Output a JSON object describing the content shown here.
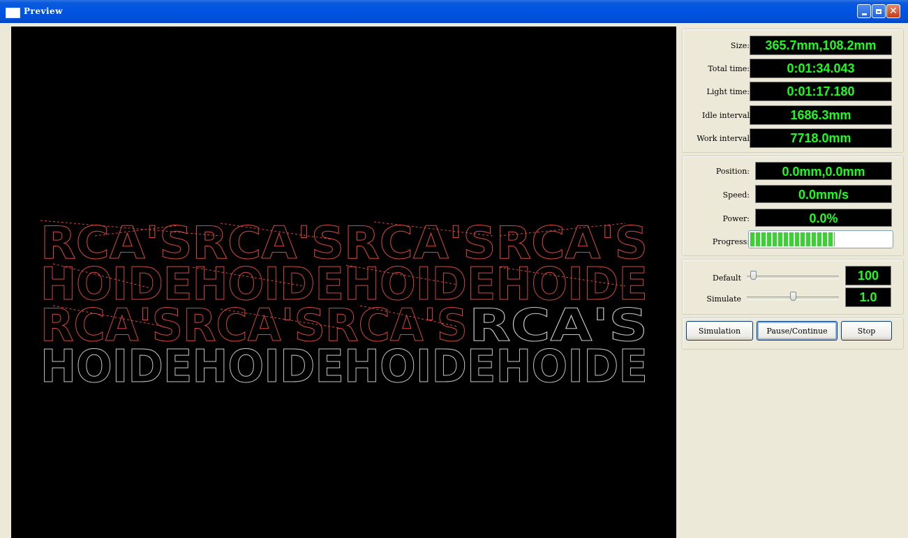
{
  "window": {
    "title": "Preview"
  },
  "colors": {
    "lcd_text": "#19ff19",
    "processed_path": "#d9473f",
    "pending_path": "#c8c8c8",
    "canvas_bg": "#000000"
  },
  "canvas": {
    "rows": [
      {
        "text": "RCA'SRCA'SRCA'SRCA'S",
        "state": "processed"
      },
      {
        "text": "HOIDEHOIDEHOIDEHOIDE",
        "state": "processed"
      },
      {
        "text": "RCA'SRCA'SRCA'S",
        "state": "processed"
      },
      {
        "text": "RCA'S",
        "state": "pending"
      },
      {
        "text": "HOIDEHOIDEHOIDEHOIDE",
        "state": "pending"
      }
    ]
  },
  "info": {
    "size_label": "Size:",
    "size_value": "365.7mm,108.2mm",
    "total_time_label": "Total time:",
    "total_time_value": "0:01:34.043",
    "light_time_label": "Light time:",
    "light_time_value": "0:01:17.180",
    "idle_interval_label": "Idle interval",
    "idle_interval_value": "1686.3mm",
    "work_interval_label": "Work interval",
    "work_interval_value": "7718.0mm"
  },
  "status": {
    "position_label": "Position:",
    "position_value": "0.0mm,0.0mm",
    "speed_label": "Speed:",
    "speed_value": "0.0mm/s",
    "power_label": "Power:",
    "power_value": "0.0%",
    "progress_label": "Progress:",
    "progress_fraction": 0.6
  },
  "sliders": {
    "default_label": "Default",
    "default_value": "100",
    "default_position": 0.07,
    "simulate_label": "Simulate",
    "simulate_value": "1.0",
    "simulate_position": 0.5
  },
  "buttons": {
    "simulation": "Simulation",
    "pause_continue": "Pause/Continue",
    "stop": "Stop"
  }
}
